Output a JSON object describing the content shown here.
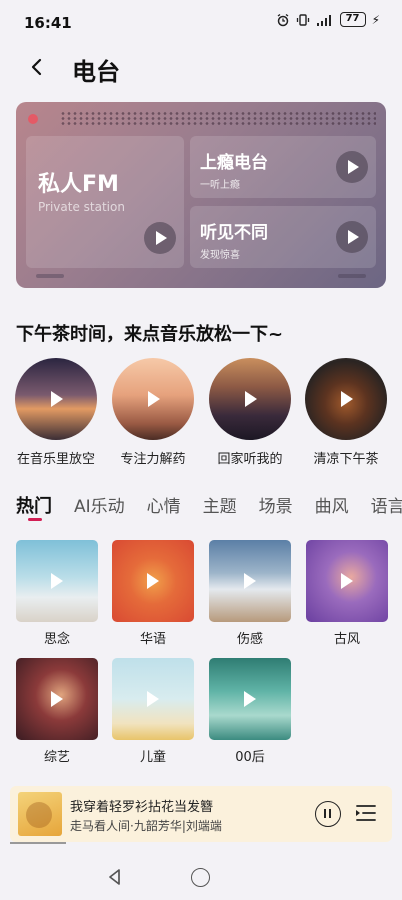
{
  "status_bar": {
    "time": "16:41",
    "battery": "77"
  },
  "header": {
    "title": "电台"
  },
  "radio_panel": {
    "main_card": {
      "title": "私人FM",
      "subtitle": "Private station"
    },
    "cards": [
      {
        "title": "上瘾电台",
        "subtitle": "一听上瘾"
      },
      {
        "title": "听见不同",
        "subtitle": "发现惊喜"
      }
    ]
  },
  "afternoon": {
    "title": "下午茶时间，来点音乐放松一下~",
    "items": [
      {
        "label": "在音乐里放空"
      },
      {
        "label": "专注力解药"
      },
      {
        "label": "回家听我的"
      },
      {
        "label": "清凉下午茶"
      }
    ]
  },
  "tabs": [
    "热门",
    "AI乐动",
    "心情",
    "主题",
    "场景",
    "曲风",
    "语言"
  ],
  "active_tab": "热门",
  "tiles": [
    {
      "label": "思念"
    },
    {
      "label": "华语"
    },
    {
      "label": "伤感"
    },
    {
      "label": "古风"
    },
    {
      "label": "综艺"
    },
    {
      "label": "儿童"
    },
    {
      "label": "00后"
    }
  ],
  "player": {
    "song": "我穿着轻罗衫拈花当发簪",
    "artist": "走马看人间·九韶芳华|刘端端"
  },
  "colors": {
    "accent": "#d21e54",
    "panel_start": "#b8868d",
    "panel_end": "#6c6683",
    "player_bg": "#fbf1dc"
  }
}
